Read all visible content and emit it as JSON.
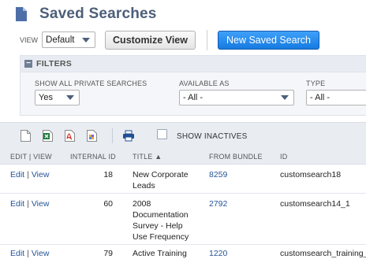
{
  "page": {
    "title": "Saved Searches"
  },
  "view": {
    "label": "VIEW",
    "selected": "Default"
  },
  "buttons": {
    "customize": "Customize View",
    "new_search": "New Saved Search"
  },
  "filters": {
    "title": "FILTERS",
    "fields": [
      {
        "label": "SHOW ALL PRIVATE SEARCHES",
        "value": "Yes"
      },
      {
        "label": "AVAILABLE AS",
        "value": "- All -"
      },
      {
        "label": "TYPE",
        "value": "- All -"
      }
    ]
  },
  "toolbar": {
    "show_inactives": "SHOW INACTIVES"
  },
  "table": {
    "columns": [
      "EDIT | VIEW",
      "INTERNAL ID",
      "TITLE ▲",
      "FROM BUNDLE",
      "ID"
    ],
    "edit_label": "Edit",
    "view_label": "View",
    "rows": [
      {
        "internal_id": "18",
        "title": "New Corporate Leads",
        "bundle": "8259",
        "id": "customsearch18"
      },
      {
        "internal_id": "60",
        "title": "2008 Documentation Survey - Help Use Frequency",
        "bundle": "2792",
        "id": "customsearch14_1"
      },
      {
        "internal_id": "79",
        "title": "Active Training",
        "bundle": "1220",
        "id": "customsearch_training_"
      }
    ]
  },
  "colors": {
    "title": "#4d5f79",
    "primary_button": "#167ae0",
    "link": "#255599"
  }
}
